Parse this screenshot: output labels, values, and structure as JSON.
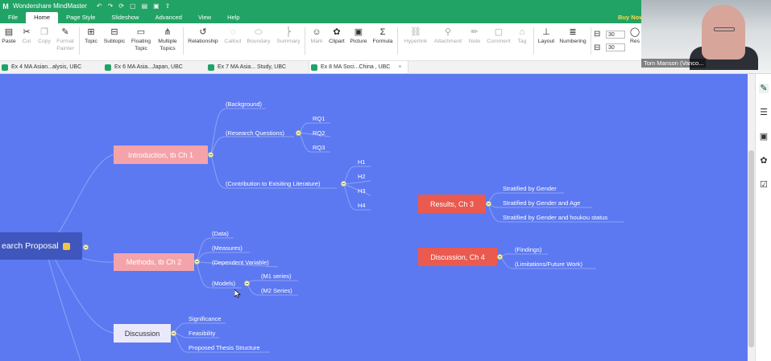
{
  "app": {
    "title": "Wondershare MindMaster",
    "logo_glyph": "M",
    "quick_access": [
      "↶",
      "↷",
      "⟳",
      "▢",
      "▤",
      "▣",
      "⇪"
    ]
  },
  "menu": {
    "items": [
      "File",
      "Home",
      "Page Style",
      "Slideshow",
      "Advanced",
      "View",
      "Help"
    ],
    "active": "Home",
    "buy": "Buy Now"
  },
  "ribbon": {
    "paste": "Paste",
    "cut": "Cut",
    "copy": "Copy",
    "format_painter_1": "Format",
    "format_painter_2": "Painter",
    "topic": "Topic",
    "subtopic": "Subtopic",
    "floating_1": "Floating",
    "floating_2": "Topic",
    "multiple_1": "Multiple",
    "multiple_2": "Topics",
    "relationship": "Relationship",
    "callout": "Callout",
    "boundary": "Boundary",
    "summary": "Summary",
    "mark": "Mark",
    "clipart": "Clipart",
    "picture": "Picture",
    "formula": "Formula",
    "hyperlink": "Hyperlink",
    "attachment": "Attachment",
    "note": "Note",
    "comment": "Comment",
    "tag": "Tag",
    "layout": "Layout",
    "numbering": "Numbering",
    "spacing_1": "30",
    "spacing_2": "30",
    "reset": "Res"
  },
  "tabs": [
    {
      "label": "Ex 4 MA Asian...alysis, UBC"
    },
    {
      "label": "Ex 6 MA Asia...Japan, UBC"
    },
    {
      "label": "Ex 7 MA Asia... Study, UBC"
    },
    {
      "label": "Ex 8 MA Soci...China , UBC",
      "close": "×"
    }
  ],
  "webcam": {
    "caption": "Tom Manson (Vanco..."
  },
  "mindmap": {
    "root": "earch Proposal",
    "intro": {
      "title": "Introduction, tb Ch 1",
      "background": "(Background)",
      "rq": "(Research Questions)",
      "rq_items": [
        "RQ1",
        "RQ2",
        "RQ3"
      ],
      "contrib": "(Contribution to Exisiting Literature)",
      "h_items": [
        "H1",
        "H2",
        "H3",
        "H4"
      ]
    },
    "methods": {
      "title": "Methods, tb Ch 2",
      "items": [
        "(Data)",
        "(Measures)",
        "(Dependent Variable)",
        "(Models)"
      ],
      "models": [
        "(M1 series)",
        "(M2 Series)"
      ]
    },
    "discussion": {
      "title": "Discussion",
      "items": [
        "Significance",
        "Feasibility",
        "Proposed Thesis Structure"
      ]
    },
    "results": {
      "title": "Results, Ch 3",
      "items": [
        "Stratified by Gender",
        "Stratified by Gender and Age",
        "Stratified  by Gender and houkou status"
      ]
    },
    "discussion4": {
      "title": "Discussion, Ch 4",
      "items": [
        "(Findings)",
        "(Limitations/Future Work)"
      ]
    }
  },
  "colors": {
    "canvas": "#5c79f2",
    "topic_pink": "#f4a3aa",
    "topic_red": "#ea5a4f",
    "root": "#3f56bc",
    "brand": "#21a366"
  },
  "right_panel_icons": [
    "format-brush-icon",
    "outline-icon",
    "gallery-icon",
    "clipart-icon",
    "task-icon"
  ]
}
